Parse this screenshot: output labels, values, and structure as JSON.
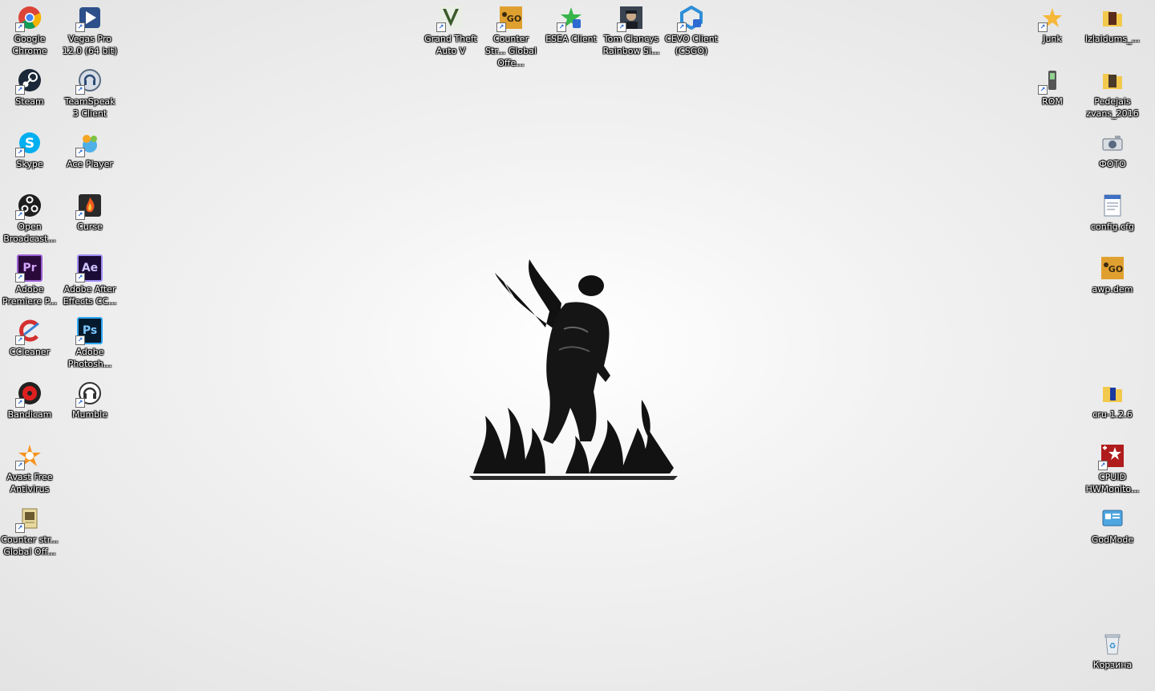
{
  "desktop": {
    "left_col1": [
      {
        "label": "Google Chrome",
        "icon": "chrome-icon"
      },
      {
        "label": "Steam",
        "icon": "steam-icon"
      },
      {
        "label": "Skype",
        "icon": "skype-icon"
      },
      {
        "label": "Open Broadcast...",
        "icon": "obs-icon"
      },
      {
        "label": "Adobe Premiere P...",
        "icon": "premiere-icon"
      },
      {
        "label": "CCleaner",
        "icon": "ccleaner-icon"
      },
      {
        "label": "Bandicam",
        "icon": "bandicam-icon"
      },
      {
        "label": "Avast Free Antivirus",
        "icon": "avast-icon"
      },
      {
        "label": "Counter str... Global Off...",
        "icon": "csgo-folder-icon"
      }
    ],
    "left_col2": [
      {
        "label": "Vegas Pro 12.0 (64 bit)",
        "icon": "vegas-icon"
      },
      {
        "label": "TeamSpeak 3 Client",
        "icon": "teamspeak-icon"
      },
      {
        "label": "Ace Player",
        "icon": "ace-player-icon"
      },
      {
        "label": "Curse",
        "icon": "curse-icon"
      },
      {
        "label": "Adobe After Effects CC...",
        "icon": "after-effects-icon"
      },
      {
        "label": "Adobe Photosh...",
        "icon": "photoshop-icon"
      },
      {
        "label": "Mumble",
        "icon": "mumble-icon"
      }
    ],
    "top_row": [
      {
        "label": "Grand Theft Auto V",
        "icon": "gta-icon"
      },
      {
        "label": "Counter Str... Global Offe...",
        "icon": "csgo-icon"
      },
      {
        "label": "ESEA Client",
        "icon": "esea-icon"
      },
      {
        "label": "Tom Clancys Rainbow Si...",
        "icon": "rainbow-six-icon"
      },
      {
        "label": "CEVO Client (CSGO)",
        "icon": "cevo-icon"
      }
    ],
    "right_col1": [
      {
        "label": "Junk",
        "icon": "junk-icon"
      },
      {
        "label": "ROM",
        "icon": "rom-icon"
      }
    ],
    "right_col2": [
      {
        "label": "Izlaidums_...",
        "icon": "izlaidums-icon"
      },
      {
        "label": "Pedejais zvans_2016",
        "icon": "pedejais-icon"
      },
      {
        "label": "ФОТО",
        "icon": "photo-folder-icon"
      },
      {
        "label": "config.cfg",
        "icon": "config-file-icon"
      },
      {
        "label": "awp.dem",
        "icon": "awp-dem-icon"
      },
      {
        "label": "cru-1.2.6",
        "icon": "cru-icon"
      },
      {
        "label": "CPUID HWMonito...",
        "icon": "hwmonitor-icon"
      },
      {
        "label": "GodMode",
        "icon": "godmode-icon"
      },
      {
        "label": "Корзина",
        "icon": "recycle-bin-icon"
      }
    ]
  },
  "colors": {
    "accent": "#1a5fd1",
    "label_text": "#ffffff"
  }
}
